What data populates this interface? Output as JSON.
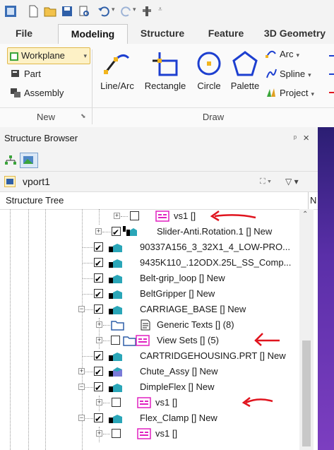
{
  "ribbon_tabs": [
    "File",
    "Modeling",
    "Structure",
    "Feature",
    "3D Geometry"
  ],
  "active_tab": "Modeling",
  "ribbon": {
    "new_group": {
      "label": "New",
      "items": [
        "Workplane",
        "Part",
        "Assembly"
      ]
    },
    "draw_group": {
      "label": "Draw",
      "big_buttons": [
        "Line/Arc",
        "Rectangle",
        "Circle",
        "Palette"
      ],
      "small_buttons": [
        "Arc",
        "Spline",
        "Project"
      ]
    }
  },
  "structure_browser": {
    "title": "Structure Browser",
    "pin": "ᵖ",
    "close": "×",
    "viewport_name": "vport1",
    "column_header": "Structure Tree",
    "column_header_right": "N",
    "rows": [
      {
        "label": "vs1 []",
        "type": "viewset",
        "checked": false
      },
      {
        "label": "Slider-Anti.Rotation.1 [] New",
        "type": "part",
        "checked": true
      },
      {
        "label": "90337A156_3_32X1_4_LOW-PRO...",
        "type": "part",
        "checked": true
      },
      {
        "label": "9435K110_.12ODX.25L_SS_Comp...",
        "type": "part",
        "checked": true
      },
      {
        "label": "Belt-grip_loop [] New",
        "type": "part",
        "checked": true
      },
      {
        "label": "BeltGripper [] New",
        "type": "part",
        "checked": true
      },
      {
        "label": "CARRIAGE_BASE [] New",
        "type": "part",
        "checked": true
      },
      {
        "label": "Generic Texts []  (8)",
        "type": "folder-text",
        "checked": null
      },
      {
        "label": "View Sets []  (5)",
        "type": "folder-viewset",
        "checked": false
      },
      {
        "label": "CARTRIDGEHOUSING.PRT [] New",
        "type": "part",
        "checked": true
      },
      {
        "label": "Chute_Assy [] New",
        "type": "assembly",
        "checked": true
      },
      {
        "label": "DimpleFlex [] New",
        "type": "part",
        "checked": true
      },
      {
        "label": "vs1 []",
        "type": "viewset",
        "checked": false
      },
      {
        "label": "Flex_Clamp [] New",
        "type": "part",
        "checked": true
      },
      {
        "label": "vs1 []",
        "type": "viewset",
        "checked": false
      }
    ]
  },
  "colors": {
    "accent_pink": "#e020c0",
    "part_teal": "#2aa6b8",
    "annotation_red": "#e0141e",
    "viewport_purple": "#5a2fa8"
  }
}
